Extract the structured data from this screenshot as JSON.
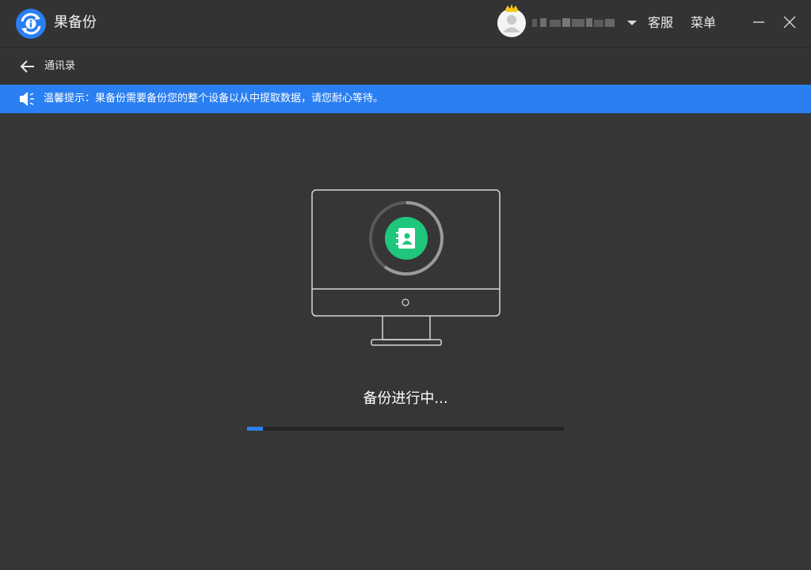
{
  "app": {
    "title": "果备份",
    "logo_icon": "backup-logo-icon",
    "brand_color": "#2a7ff2"
  },
  "header": {
    "avatar_icon": "user-avatar-icon",
    "crown_icon": "vip-crown-icon",
    "username_masked": true,
    "dropdown_icon": "caret-down-icon",
    "service_label": "客服",
    "menu_label": "菜单",
    "minimize_icon": "minimize-icon",
    "close_icon": "close-icon"
  },
  "nav": {
    "back_icon": "arrow-left-icon",
    "back_label": "通讯录"
  },
  "notice": {
    "icon": "speaker-icon",
    "text": "温馨提示：果备份需要备份您的整个设备以从中提取数据，请您耐心等待。",
    "bg_color": "#2a7ff2"
  },
  "backup": {
    "illustration_icon": "monitor-contacts-icon",
    "contacts_icon": "contacts-book-icon",
    "status": "备份进行中...",
    "progress": 0.05,
    "progress_color": "#2a7ff2"
  }
}
